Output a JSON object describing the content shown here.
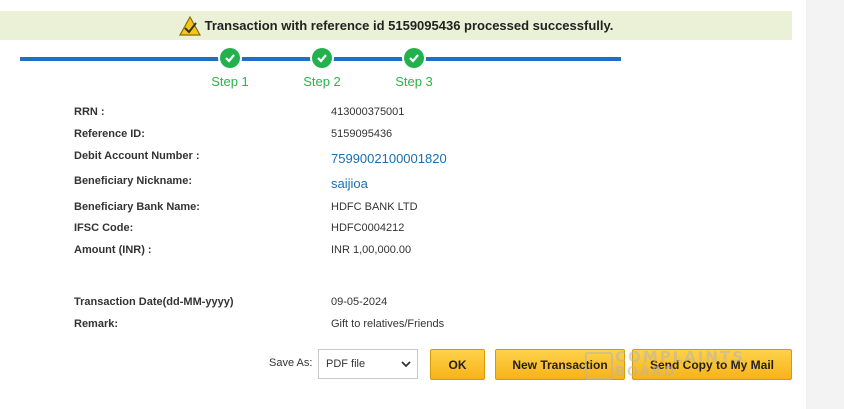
{
  "banner": {
    "message": "Transaction with reference id 5159095436 processed successfully.",
    "icon": "warning-icon"
  },
  "steps": [
    {
      "label": "Step 1",
      "status": "complete"
    },
    {
      "label": "Step 2",
      "status": "complete"
    },
    {
      "label": "Step 3",
      "status": "complete"
    }
  ],
  "details": [
    {
      "label": "RRN :",
      "value": "413000375001"
    },
    {
      "label": "Reference ID:",
      "value": "5159095436"
    },
    {
      "label": "Debit Account Number :",
      "value": "7599002100001820"
    },
    {
      "label": "Beneficiary Nickname:",
      "value": "saijioa"
    },
    {
      "label": "Beneficiary Bank Name:",
      "value": "HDFC BANK LTD"
    },
    {
      "label": "IFSC Code:",
      "value": "HDFC0004212"
    },
    {
      "label": "Amount (INR) :",
      "value": "INR 1,00,000.00"
    },
    {
      "label": "Transaction Date(dd-MM-yyyy)",
      "value": "09-05-2024"
    },
    {
      "label": "Remark:",
      "value": "Gift to relatives/Friends"
    }
  ],
  "actions": {
    "save_as_label": "Save As:",
    "format_selected": "PDF file",
    "ok_label": "OK",
    "new_transaction_label": "New Transaction",
    "send_copy_label": "Send Copy to My Mail"
  },
  "watermark": {
    "line1": "COMPLAINTS",
    "line2": "BOARD"
  },
  "colors": {
    "banner_bg": "#eaf1d6",
    "step_bar": "#1e6fc6",
    "step_complete": "#22b14c",
    "link_value": "#1a6fb0",
    "button_bg": "#f7b21a"
  }
}
